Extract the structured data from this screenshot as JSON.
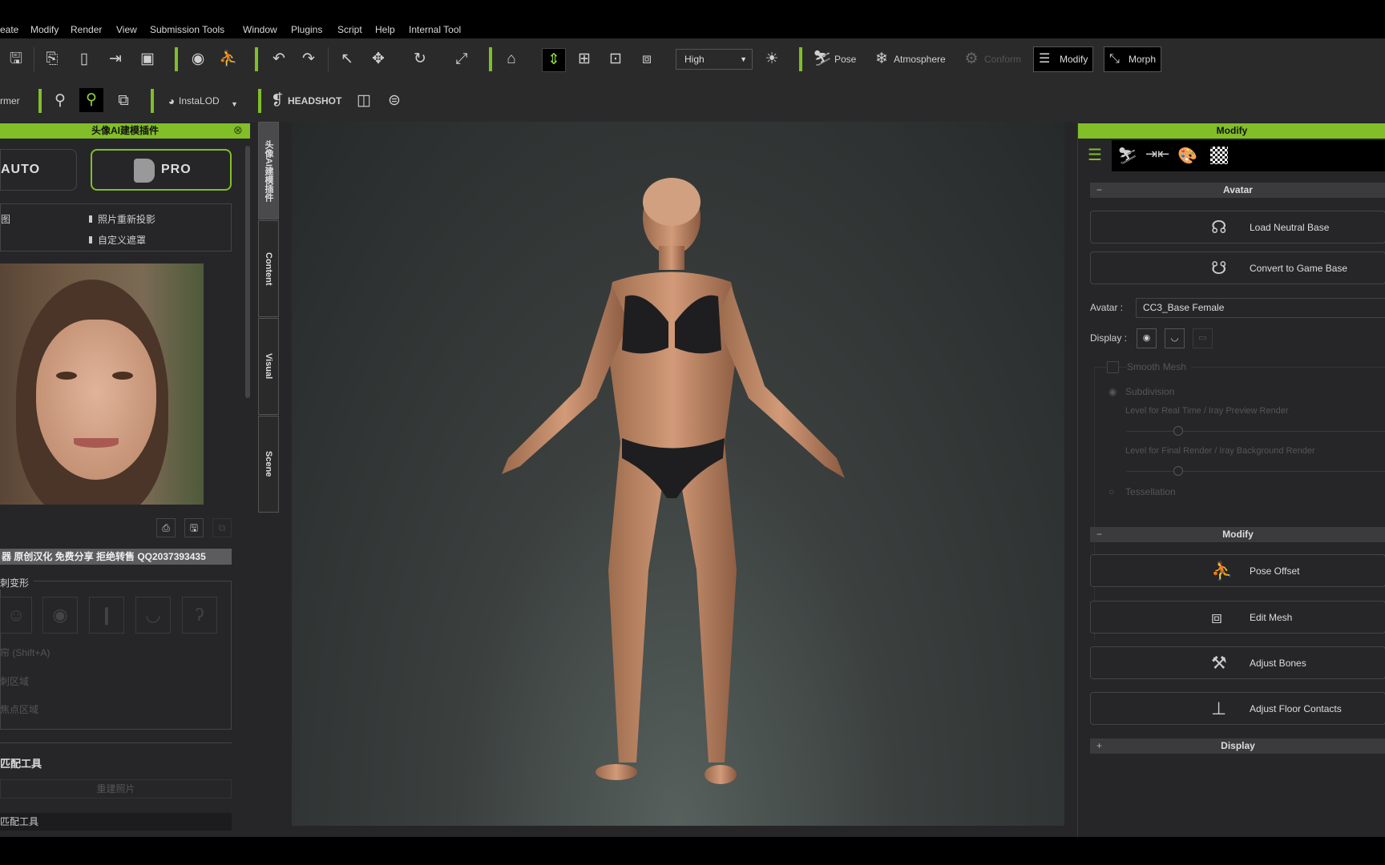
{
  "menu": [
    "eate",
    "Modify",
    "Render",
    "View",
    "Submission Tools",
    "Window",
    "Plugins",
    "Script",
    "Help",
    "Internal Tool"
  ],
  "toolbar1": {
    "quality_select": "High",
    "pose": "Pose",
    "atmosphere": "Atmosphere",
    "conform": "Conform",
    "modify": "Modify",
    "morph": "Morph"
  },
  "toolbar2": {
    "former_label": "rmer",
    "instalod": "InstaLOD",
    "headshot": "HEADSHOT"
  },
  "left_panel": {
    "title": "头像AI建模插件",
    "auto_button": "AUTO",
    "pro_button": "PRO",
    "options": {
      "left_item": "图",
      "items": [
        "照片重新投影",
        "自定义遮罩"
      ]
    },
    "banner": "器 原创汉化 免费分享 拒绝转售 QQ2037393435",
    "group_label": "刺变形",
    "disabled_items": [
      "帘 (Shift+A)",
      "刺区域",
      "焦点区域"
    ],
    "section_title": "匹配工具",
    "rebuild_button": "重建照片",
    "bottom_item": "匹配工具"
  },
  "vertical_tabs": [
    "头像AI建模插件",
    "Content",
    "Visual",
    "Scene"
  ],
  "right_panel": {
    "title": "Modify",
    "avatar_section": "Avatar",
    "load_neutral_base": "Load Neutral Base",
    "convert_game_base": "Convert to Game Base",
    "avatar_label": "Avatar :",
    "avatar_value": "CC3_Base Female",
    "display_label": "Display :",
    "smooth_mesh": "Smooth Mesh",
    "subdivision": "Subdivision",
    "level_realtime": "Level for Real Time / Iray Preview Render",
    "level_final": "Level for Final Render / Iray Background Render",
    "tessellation": "Tessellation",
    "modify_section": "Modify",
    "pose_offset": "Pose Offset",
    "edit_mesh": "Edit Mesh",
    "adjust_bones": "Adjust Bones",
    "adjust_floor": "Adjust Floor Contacts",
    "display_section": "Display",
    "slider_realtime": 0.2,
    "slider_final": 0.2
  },
  "colors": {
    "accent": "#82be28",
    "panel": "#262628",
    "toolbar": "#2a2a2b"
  }
}
